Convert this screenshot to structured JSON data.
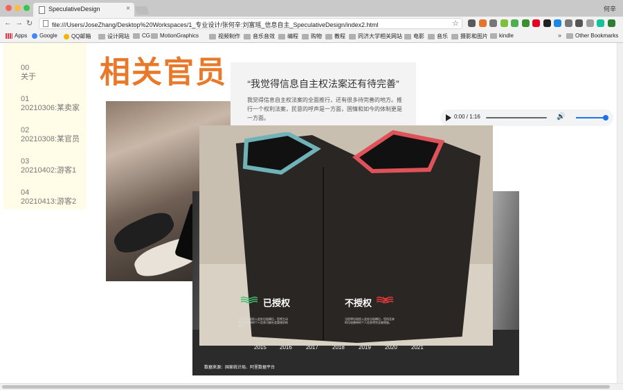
{
  "browser": {
    "tab_title": "SpeculativeDesign",
    "tab_close": "×",
    "profile": "何辛",
    "url": "file:///Users/JoseZhang/Desktop%20Workspaces/1_专业设计/张何辛:刘富瑶_信息自主_SpeculativeDesign/index2.html",
    "nav": {
      "back": "←",
      "forward": "→",
      "reload": "↻"
    },
    "star": "☆",
    "extensions": [
      {
        "name": "evernote-icon",
        "color": "#5a5a5a"
      },
      {
        "name": "fox-icon",
        "color": "#e6732b"
      },
      {
        "name": "formula-icon",
        "color": "#777777"
      },
      {
        "name": "dropper-icon",
        "color": "#7bbf3a"
      },
      {
        "name": "green-shield-icon",
        "color": "#4caf50"
      },
      {
        "name": "download-icon",
        "color": "#3a8f2f"
      },
      {
        "name": "pinterest-icon",
        "color": "#e60023"
      },
      {
        "name": "dot-icon",
        "color": "#222222"
      },
      {
        "name": "v-icon",
        "color": "#1e88e5"
      },
      {
        "name": "puzzle-icon",
        "color": "#777777"
      },
      {
        "name": "pocket-icon",
        "color": "#555555"
      },
      {
        "name": "shield-icon",
        "color": "#9e9e9e"
      },
      {
        "name": "grammarly-icon",
        "color": "#15c39a"
      },
      {
        "name": "circle-green-icon",
        "color": "#2e7d32"
      }
    ]
  },
  "bookmarks": {
    "items": [
      {
        "label": "Apps",
        "icon": "apps-grid-icon"
      },
      {
        "label": "Google",
        "icon": "google-icon"
      },
      {
        "label": "QQ邮箱",
        "icon": "qq-icon"
      },
      {
        "label": "设计网站",
        "icon": "folder-icon"
      },
      {
        "label": "CG",
        "icon": "folder-icon"
      },
      {
        "label": "MotionGraphics",
        "icon": "folder-icon"
      },
      {
        "label": "视频制作",
        "icon": "folder-icon"
      },
      {
        "label": "音乐音效",
        "icon": "folder-icon"
      },
      {
        "label": "编程",
        "icon": "folder-icon"
      },
      {
        "label": "购物",
        "icon": "folder-icon"
      },
      {
        "label": "教程",
        "icon": "folder-icon"
      },
      {
        "label": "同济大学相关网站",
        "icon": "folder-icon"
      },
      {
        "label": "电影",
        "icon": "folder-icon"
      },
      {
        "label": "音乐",
        "icon": "folder-icon"
      },
      {
        "label": "摄影和图片",
        "icon": "folder-icon"
      },
      {
        "label": "kindle",
        "icon": "folder-icon"
      }
    ],
    "more": "»",
    "other": "Other Bookmarks"
  },
  "sidebar": {
    "items": [
      {
        "num": "00",
        "label": "关于"
      },
      {
        "num": "01",
        "label": "20210306:某卖家"
      },
      {
        "num": "02",
        "label": "20210308:某官员"
      },
      {
        "num": "03",
        "label": "20210402:游客1"
      },
      {
        "num": "04",
        "label": "20210413:游客2"
      }
    ]
  },
  "main": {
    "title": "相关官员",
    "quote": {
      "title": "“我觉得信息自主权法案还有待完善”",
      "body": "我觉得信息自主权法案的全面推行，还有很多待完善的地方。推行一个权利法案，民意的呼声是一方面，国情和如今的体制更是一方面。"
    },
    "audio": {
      "time": "0:00 / 1:16"
    },
    "bins": {
      "left_label": "已授权",
      "right_label": "不授权",
      "left_small": "当您将垃圾投入此处垃圾桶后，您将主动的垃圾所带的个人信息可被社会管理机构使用。",
      "right_small": "当您将垃圾投入此处垃圾桶后，您所丢弃的垃圾携带的个人信息将完全被销毁。"
    },
    "chart": {
      "years": [
        "2015",
        "2016",
        "2017",
        "2018",
        "2019",
        "2020",
        "2021"
      ],
      "source": "数据来源：国家统计局、阿里数据平台"
    }
  }
}
